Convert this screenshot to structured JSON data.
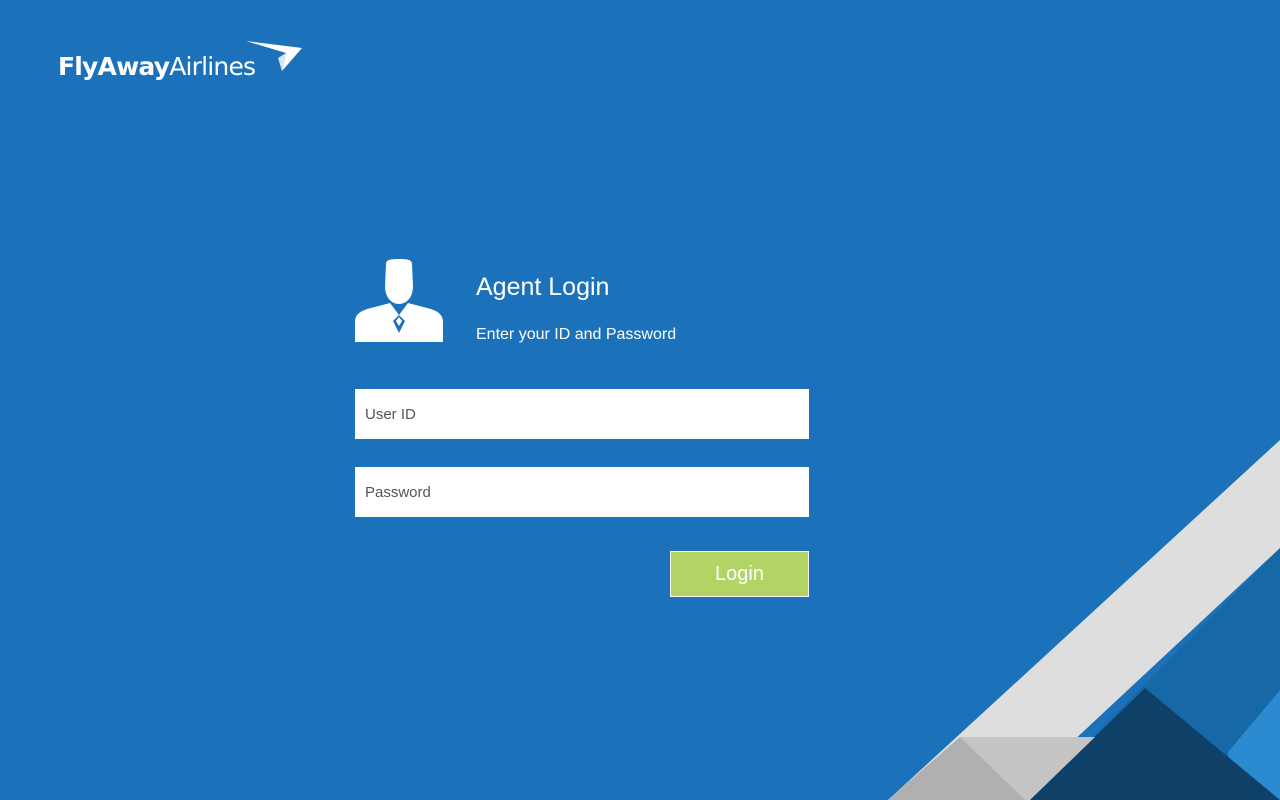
{
  "brand": {
    "name_part1": "FlyAway",
    "name_part2": "Airlines",
    "logo_icon": "paper-plane-swoosh-icon"
  },
  "login": {
    "avatar_icon": "agent-person-icon",
    "title": "Agent Login",
    "subtitle": "Enter your ID and Password",
    "user_id_placeholder": "User ID",
    "user_id_value": "",
    "password_placeholder": "Password",
    "password_value": "",
    "button_label": "Login"
  },
  "colors": {
    "background": "#1b72ba",
    "button": "#b3d465",
    "corner_light_gray": "#dedede",
    "corner_mid_gray": "#c4c4c4",
    "corner_navy": "#0f4068",
    "corner_blue": "#1768a6"
  }
}
